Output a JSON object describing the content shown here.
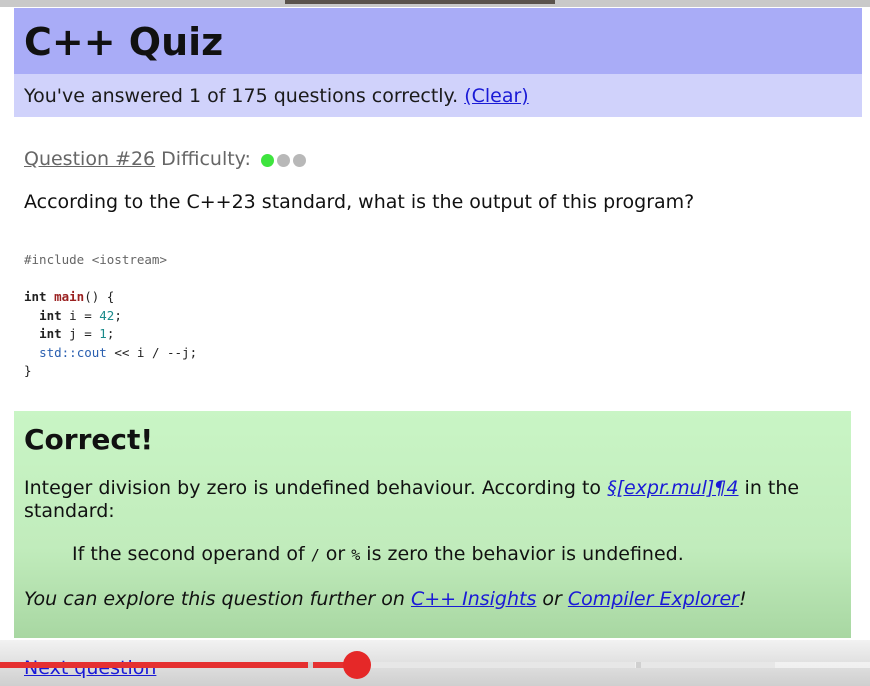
{
  "header": {
    "title": "C++ Quiz",
    "progress_text": "You've answered 1 of 175 questions correctly.",
    "clear_link": "(Clear)"
  },
  "question": {
    "number_link": "Question #26",
    "difficulty_label": "Difficulty:",
    "difficulty_level": 1,
    "difficulty_max": 3,
    "prompt": "According to the C++23 standard, what is the output of this program?"
  },
  "code": {
    "include": "#include <iostream>",
    "line_main_type": "int",
    "line_main_name": "main",
    "line_main_rest": "() {",
    "line_i_type": "int",
    "line_i_decl": " i = ",
    "line_i_val": "42",
    "line_i_end": ";",
    "line_j_type": "int",
    "line_j_decl": " j = ",
    "line_j_val": "1",
    "line_j_end": ";",
    "line_cout_ns": "std::cout",
    "line_cout_rest": " << i / --j;",
    "close": "}"
  },
  "result": {
    "title": "Correct!",
    "explanation_prefix": "Integer division by zero is undefined behaviour. According to ",
    "standard_link": "§[expr.mul]¶4",
    "explanation_suffix": " in the standard:",
    "quote_prefix": "If the second operand of ",
    "quote_op1": "/",
    "quote_or": " or ",
    "quote_op2": "%",
    "quote_suffix": " is zero the behavior is undefined.",
    "explore_prefix": "You can explore this question further on ",
    "insights_link": "C++ Insights",
    "explore_or": " or ",
    "compiler_link": "Compiler Explorer",
    "explore_suffix": "!"
  },
  "footer": {
    "next_link": "Next question"
  },
  "video_progress": {
    "played_fraction": 0.41
  },
  "colors": {
    "header_bg": "#a9acf7",
    "subheader_bg": "#d0d2fb",
    "result_bg": "#c1ecbc",
    "link": "#1a1ad6",
    "difficulty_active": "#3ee43e",
    "difficulty_inactive": "#b8b8b8",
    "progress_red": "#e53030"
  }
}
